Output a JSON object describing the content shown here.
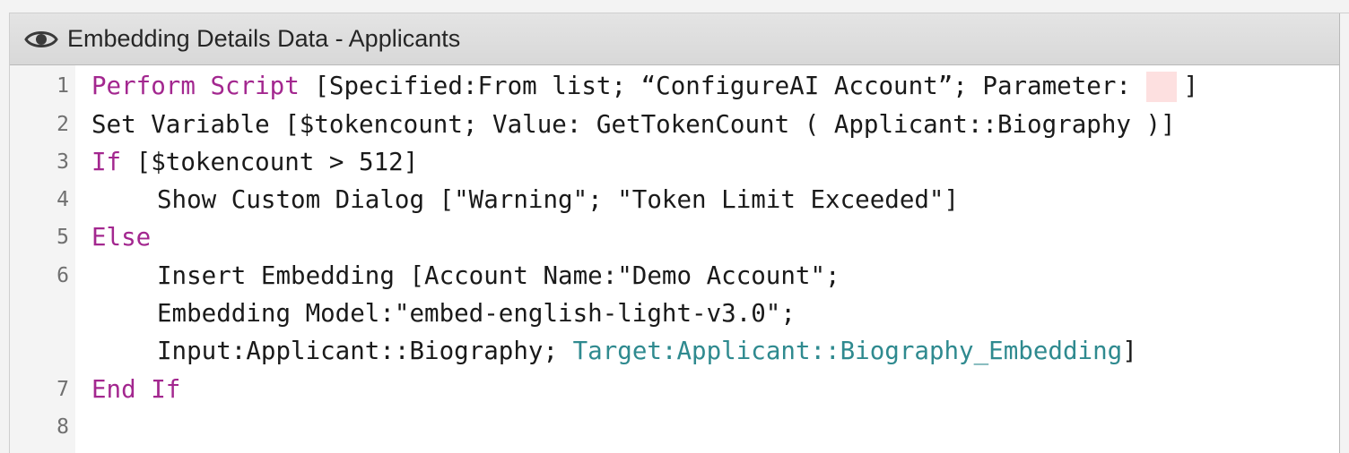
{
  "window": {
    "title": "Embedding Details Data - Applicants",
    "title_icon": "eye-icon"
  },
  "colors": {
    "keyword": "#a3278f",
    "target": "#2f8a8f",
    "text": "#1a1a1a",
    "line_number": "#707070",
    "parameter_highlight": "#fde0e0"
  },
  "lines": [
    {
      "number": "1",
      "keyword": "Perform Script",
      "text": " [Specified:From list; “ConfigureAI Account”; Parameter: ",
      "end": "]"
    },
    {
      "number": "2",
      "text": "Set Variable [$tokencount; Value: GetTokenCount ( Applicant::Biography )]"
    },
    {
      "number": "3",
      "keyword": "If",
      "text": " [$tokencount > 512]"
    },
    {
      "number": "4",
      "text": "Show Custom Dialog [\"Warning\"; \"Token Limit Exceeded\"]"
    },
    {
      "number": "5",
      "keyword": "Else"
    },
    {
      "number": "6",
      "text": "Insert Embedding [Account Name:\"Demo Account\";",
      "cont1": "Embedding Model:\"embed-english-light-v3.0\";",
      "cont2_plain": "Input:Applicant::Biography; ",
      "cont2_target": "Target:Applicant::Biography_Embedding",
      "cont2_end": "]"
    },
    {
      "number": "7",
      "keyword": "End If"
    },
    {
      "number": "8"
    }
  ]
}
